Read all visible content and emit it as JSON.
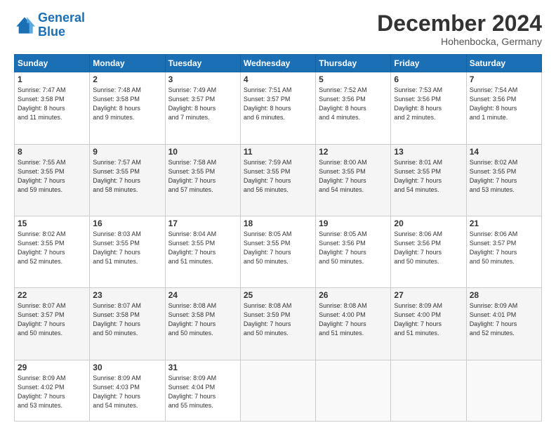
{
  "header": {
    "logo_general": "General",
    "logo_blue": "Blue",
    "month": "December 2024",
    "location": "Hohenbocka, Germany"
  },
  "days_of_week": [
    "Sunday",
    "Monday",
    "Tuesday",
    "Wednesday",
    "Thursday",
    "Friday",
    "Saturday"
  ],
  "weeks": [
    [
      {
        "day": "1",
        "info": "Sunrise: 7:47 AM\nSunset: 3:58 PM\nDaylight: 8 hours\nand 11 minutes."
      },
      {
        "day": "2",
        "info": "Sunrise: 7:48 AM\nSunset: 3:58 PM\nDaylight: 8 hours\nand 9 minutes."
      },
      {
        "day": "3",
        "info": "Sunrise: 7:49 AM\nSunset: 3:57 PM\nDaylight: 8 hours\nand 7 minutes."
      },
      {
        "day": "4",
        "info": "Sunrise: 7:51 AM\nSunset: 3:57 PM\nDaylight: 8 hours\nand 6 minutes."
      },
      {
        "day": "5",
        "info": "Sunrise: 7:52 AM\nSunset: 3:56 PM\nDaylight: 8 hours\nand 4 minutes."
      },
      {
        "day": "6",
        "info": "Sunrise: 7:53 AM\nSunset: 3:56 PM\nDaylight: 8 hours\nand 2 minutes."
      },
      {
        "day": "7",
        "info": "Sunrise: 7:54 AM\nSunset: 3:56 PM\nDaylight: 8 hours\nand 1 minute."
      }
    ],
    [
      {
        "day": "8",
        "info": "Sunrise: 7:55 AM\nSunset: 3:55 PM\nDaylight: 7 hours\nand 59 minutes."
      },
      {
        "day": "9",
        "info": "Sunrise: 7:57 AM\nSunset: 3:55 PM\nDaylight: 7 hours\nand 58 minutes."
      },
      {
        "day": "10",
        "info": "Sunrise: 7:58 AM\nSunset: 3:55 PM\nDaylight: 7 hours\nand 57 minutes."
      },
      {
        "day": "11",
        "info": "Sunrise: 7:59 AM\nSunset: 3:55 PM\nDaylight: 7 hours\nand 56 minutes."
      },
      {
        "day": "12",
        "info": "Sunrise: 8:00 AM\nSunset: 3:55 PM\nDaylight: 7 hours\nand 54 minutes."
      },
      {
        "day": "13",
        "info": "Sunrise: 8:01 AM\nSunset: 3:55 PM\nDaylight: 7 hours\nand 54 minutes."
      },
      {
        "day": "14",
        "info": "Sunrise: 8:02 AM\nSunset: 3:55 PM\nDaylight: 7 hours\nand 53 minutes."
      }
    ],
    [
      {
        "day": "15",
        "info": "Sunrise: 8:02 AM\nSunset: 3:55 PM\nDaylight: 7 hours\nand 52 minutes."
      },
      {
        "day": "16",
        "info": "Sunrise: 8:03 AM\nSunset: 3:55 PM\nDaylight: 7 hours\nand 51 minutes."
      },
      {
        "day": "17",
        "info": "Sunrise: 8:04 AM\nSunset: 3:55 PM\nDaylight: 7 hours\nand 51 minutes."
      },
      {
        "day": "18",
        "info": "Sunrise: 8:05 AM\nSunset: 3:55 PM\nDaylight: 7 hours\nand 50 minutes."
      },
      {
        "day": "19",
        "info": "Sunrise: 8:05 AM\nSunset: 3:56 PM\nDaylight: 7 hours\nand 50 minutes."
      },
      {
        "day": "20",
        "info": "Sunrise: 8:06 AM\nSunset: 3:56 PM\nDaylight: 7 hours\nand 50 minutes."
      },
      {
        "day": "21",
        "info": "Sunrise: 8:06 AM\nSunset: 3:57 PM\nDaylight: 7 hours\nand 50 minutes."
      }
    ],
    [
      {
        "day": "22",
        "info": "Sunrise: 8:07 AM\nSunset: 3:57 PM\nDaylight: 7 hours\nand 50 minutes."
      },
      {
        "day": "23",
        "info": "Sunrise: 8:07 AM\nSunset: 3:58 PM\nDaylight: 7 hours\nand 50 minutes."
      },
      {
        "day": "24",
        "info": "Sunrise: 8:08 AM\nSunset: 3:58 PM\nDaylight: 7 hours\nand 50 minutes."
      },
      {
        "day": "25",
        "info": "Sunrise: 8:08 AM\nSunset: 3:59 PM\nDaylight: 7 hours\nand 50 minutes."
      },
      {
        "day": "26",
        "info": "Sunrise: 8:08 AM\nSunset: 4:00 PM\nDaylight: 7 hours\nand 51 minutes."
      },
      {
        "day": "27",
        "info": "Sunrise: 8:09 AM\nSunset: 4:00 PM\nDaylight: 7 hours\nand 51 minutes."
      },
      {
        "day": "28",
        "info": "Sunrise: 8:09 AM\nSunset: 4:01 PM\nDaylight: 7 hours\nand 52 minutes."
      }
    ],
    [
      {
        "day": "29",
        "info": "Sunrise: 8:09 AM\nSunset: 4:02 PM\nDaylight: 7 hours\nand 53 minutes."
      },
      {
        "day": "30",
        "info": "Sunrise: 8:09 AM\nSunset: 4:03 PM\nDaylight: 7 hours\nand 54 minutes."
      },
      {
        "day": "31",
        "info": "Sunrise: 8:09 AM\nSunset: 4:04 PM\nDaylight: 7 hours\nand 55 minutes."
      },
      {
        "day": "",
        "info": ""
      },
      {
        "day": "",
        "info": ""
      },
      {
        "day": "",
        "info": ""
      },
      {
        "day": "",
        "info": ""
      }
    ]
  ]
}
